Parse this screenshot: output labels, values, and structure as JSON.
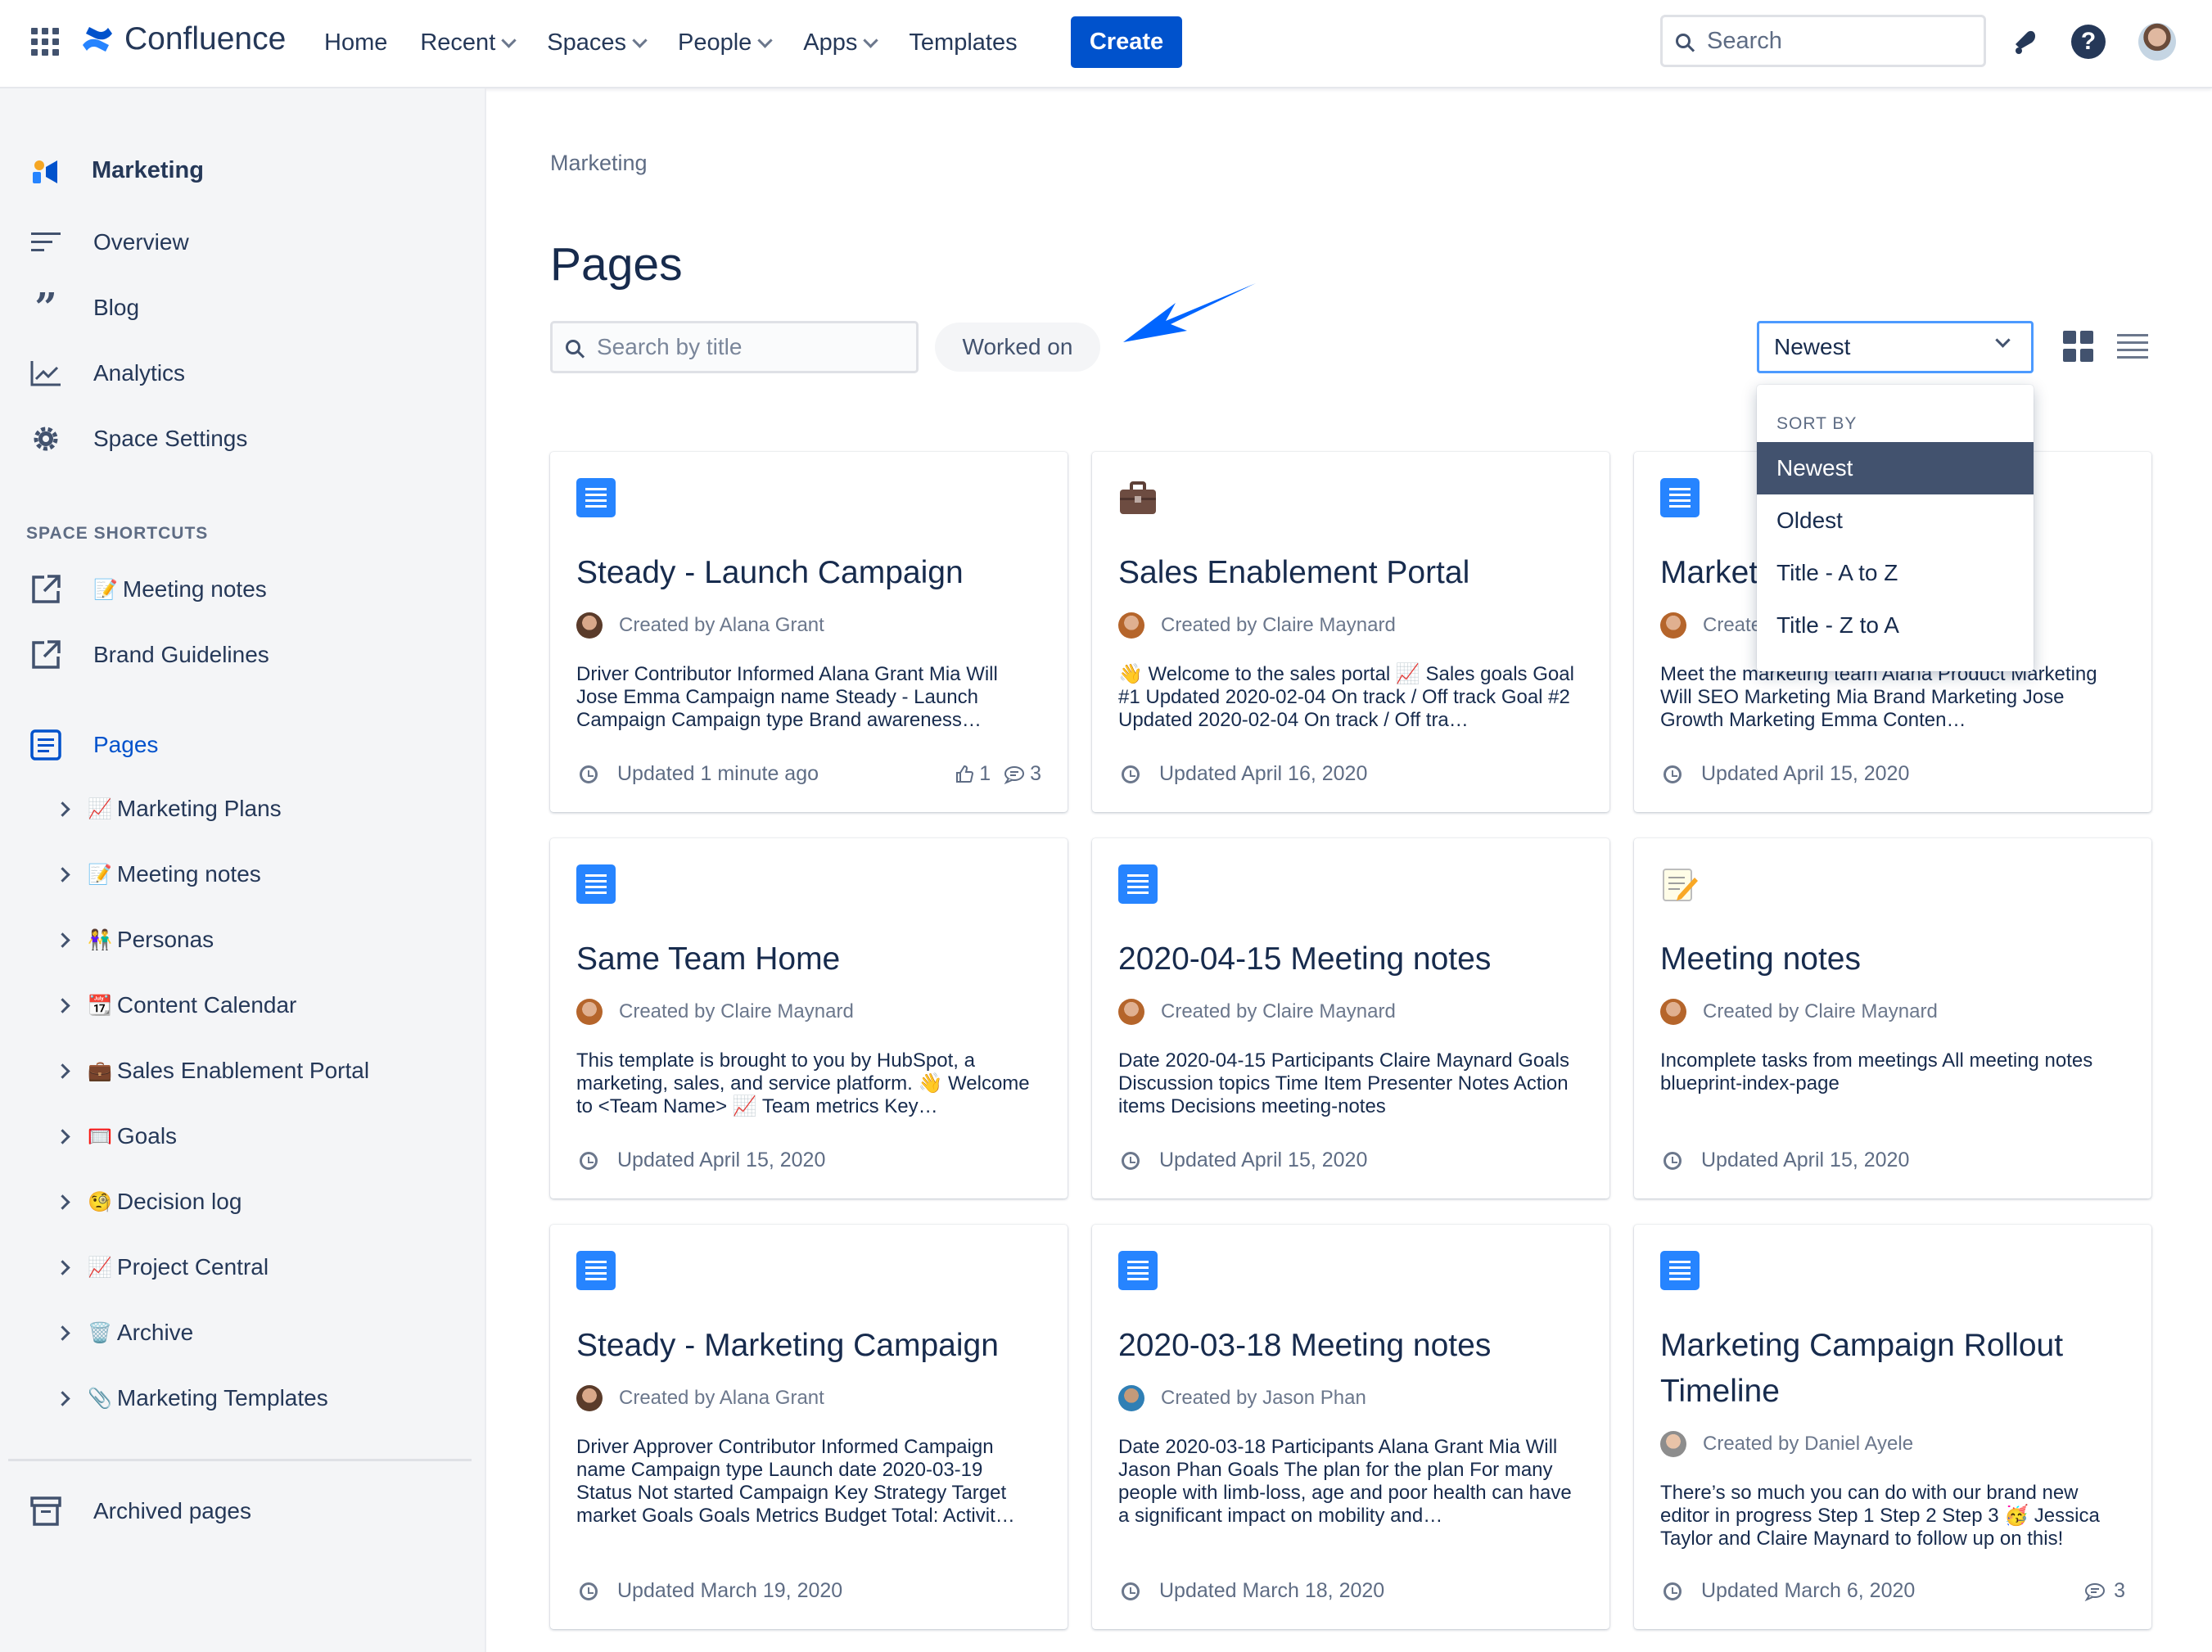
{
  "topnav": {
    "brand": "Confluence",
    "items": [
      {
        "label": "Home",
        "has_menu": false
      },
      {
        "label": "Recent",
        "has_menu": true
      },
      {
        "label": "Spaces",
        "has_menu": true
      },
      {
        "label": "People",
        "has_menu": true
      },
      {
        "label": "Apps",
        "has_menu": true
      },
      {
        "label": "Templates",
        "has_menu": false
      }
    ],
    "create_label": "Create",
    "search_placeholder": "Search",
    "accent": "#0052cc"
  },
  "sidebar": {
    "space_name": "Marketing",
    "items": [
      {
        "label": "Overview",
        "icon": "overview-icon"
      },
      {
        "label": "Blog",
        "icon": "quote-icon"
      },
      {
        "label": "Analytics",
        "icon": "analytics-icon"
      },
      {
        "label": "Space Settings",
        "icon": "gear-icon"
      }
    ],
    "shortcuts_heading": "SPACE SHORTCUTS",
    "shortcuts": [
      {
        "label": "Meeting notes",
        "emoji": "📝",
        "icon": "external-link-icon"
      },
      {
        "label": "Brand Guidelines",
        "emoji": "",
        "icon": "external-link-icon"
      }
    ],
    "pages_label": "Pages",
    "tree": [
      {
        "label": "Marketing Plans",
        "emoji": "📈"
      },
      {
        "label": "Meeting notes",
        "emoji": "📝"
      },
      {
        "label": "Personas",
        "emoji": "👫"
      },
      {
        "label": "Content Calendar",
        "emoji": "📆"
      },
      {
        "label": "Sales Enablement Portal",
        "emoji": "💼"
      },
      {
        "label": "Goals",
        "emoji": "🥅"
      },
      {
        "label": "Decision log",
        "emoji": "🧐"
      },
      {
        "label": "Project Central",
        "emoji": "📈"
      },
      {
        "label": "Archive",
        "emoji": "🗑️"
      },
      {
        "label": "Marketing Templates",
        "emoji": "📎"
      }
    ],
    "archived_label": "Archived pages"
  },
  "main": {
    "breadcrumb": "Marketing",
    "title": "Pages",
    "filter_placeholder": "Search by title",
    "worked_on_label": "Worked on",
    "sort_value": "Newest",
    "sort_menu": {
      "heading": "SORT BY",
      "options": [
        "Newest",
        "Oldest",
        "Title - A to Z",
        "Title - Z to A"
      ],
      "selected": "Newest"
    }
  },
  "cards": [
    {
      "icon": "document-icon",
      "title": "Steady - Launch Campaign",
      "author": "Created by Alana Grant",
      "excerpt": "Driver Contributor Informed Alana Grant Mia Will Jose Emma Campaign name Steady - Launch Campaign Campaign type Brand awareness…",
      "updated": "Updated 1 minute ago",
      "likes": "1",
      "comments": "3"
    },
    {
      "icon": "briefcase-icon",
      "title": "Sales Enablement Portal",
      "author": "Created by Claire Maynard",
      "excerpt": "👋 Welcome to the sales portal 📈 Sales goals Goal #1 Updated 2020-02-04 On track / Off track Goal #2 Updated 2020-02-04 On track / Off tra…",
      "updated": "Updated April 16, 2020",
      "likes": "",
      "comments": ""
    },
    {
      "icon": "document-icon",
      "title": "Market",
      "author": "Create",
      "excerpt": "Meet the marketing team Alana Product Marketing Will SEO Marketing Mia Brand Marketing Jose Growth Marketing Emma Conten…",
      "updated": "Updated April 15, 2020",
      "likes": "",
      "comments": ""
    },
    {
      "icon": "document-icon",
      "title": "Same Team Home",
      "author": "Created by Claire Maynard",
      "excerpt": "This template is brought to you by HubSpot, a marketing, sales, and service platform. 👋 Welcome to <Team Name> 📈 Team metrics Key…",
      "updated": "Updated April 15, 2020",
      "likes": "",
      "comments": ""
    },
    {
      "icon": "document-icon",
      "title": "2020-04-15 Meeting notes",
      "author": "Created by Claire Maynard",
      "excerpt": "Date 2020-04-15 Participants Claire Maynard Goals Discussion topics Time Item Presenter Notes Action items Decisions meeting-notes",
      "updated": "Updated April 15, 2020",
      "likes": "",
      "comments": ""
    },
    {
      "icon": "memo-icon",
      "title": "Meeting notes",
      "author": "Created by Claire Maynard",
      "excerpt": "Incomplete tasks from meetings All meeting notes blueprint-index-page",
      "updated": "Updated April 15, 2020",
      "likes": "",
      "comments": ""
    },
    {
      "icon": "document-icon",
      "title": "Steady - Marketing Campaign",
      "author": "Created by Alana Grant",
      "excerpt": "Driver Approver Contributor Informed Campaign name Campaign type Launch date 2020-03-19 Status Not started Campaign Key Strategy Target market Goals Goals Metrics Budget Total: Activit…",
      "updated": "Updated March 19, 2020",
      "likes": "",
      "comments": ""
    },
    {
      "icon": "document-icon",
      "title": "2020-03-18 Meeting notes",
      "author": "Created by Jason Phan",
      "excerpt": "Date 2020-03-18 Participants Alana Grant Mia Will Jason Phan Goals The plan for the plan For many people with limb-loss, age and poor health can have a significant impact on mobility and…",
      "updated": "Updated March 18, 2020",
      "likes": "",
      "comments": ""
    },
    {
      "icon": "document-icon",
      "title": "Marketing Campaign Rollout Timeline",
      "author": "Created by Daniel Ayele",
      "excerpt": "There’s so much you can do with our brand new editor in progress Step 1 Step 2 Step 3 🥳 Jessica Taylor and Claire Maynard to follow up on this!",
      "updated": "Updated March 6, 2020",
      "likes": "",
      "comments": "3"
    }
  ]
}
